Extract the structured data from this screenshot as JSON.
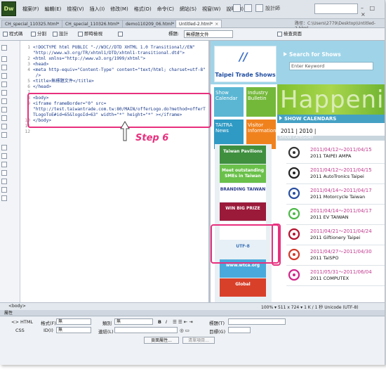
{
  "app": {
    "logo": "Dw"
  },
  "menubar": {
    "items": [
      "檔案(F)",
      "編輯(E)",
      "檢視(V)",
      "插入(I)",
      "修改(M)",
      "格式(O)",
      "命令(C)",
      "網站(S)",
      "視窗(W)",
      "說明(H)"
    ],
    "workspace": "設計師",
    "window_controls": "– □ ×"
  },
  "tabs": [
    {
      "label": "CH_special_110325.html*",
      "close": "×"
    },
    {
      "label": "CH_special_110326.html*",
      "close": "×"
    },
    {
      "label": "demo110209_06.html*",
      "close": "×"
    },
    {
      "label": "Untitled-2.html*",
      "close": "×"
    }
  ],
  "path": "路徑：C:\\Users\\2779\\Desktop\\Untitled-2.html",
  "toolbar": {
    "code": "程式碼",
    "split": "分割",
    "design": "設計",
    "live_view": "即時檢視",
    "title_label": "標題:",
    "title_value": "無標題文件",
    "check_page": "檢查頁面"
  },
  "code_lines": [
    {
      "n": "1",
      "text": "<!DOCTYPE html PUBLIC \"-//W3C//DTD XHTML 1.0 Transitional//EN\""
    },
    {
      "n": "",
      "text": "\"http://www.w3.org/TR/xhtml1/DTD/xhtml1-transitional.dtd\">"
    },
    {
      "n": "2",
      "text": "<html xmlns=\"http://www.w3.org/1999/xhtml\">"
    },
    {
      "n": "3",
      "text": "<head>"
    },
    {
      "n": "4",
      "text": "<meta http-equiv=\"Content-Type\" content=\"text/html; charset=utf-8\""
    },
    {
      "n": "",
      "text": " />"
    },
    {
      "n": "5",
      "text": "<title>無標題文件</title>"
    },
    {
      "n": "6",
      "text": "</head>"
    },
    {
      "n": "7",
      "text": ""
    },
    {
      "n": "8",
      "text": "<body>"
    },
    {
      "n": "9",
      "text": "<iframe frameBorder=\"0\" src="
    },
    {
      "n": "",
      "text": "\"http://test.taiwantrade.com.tw:80/MAIN/offerLogo.do?method=offerT"
    },
    {
      "n": "",
      "text": "TLogoToE#id=65&logoId=63\" width=\"*\" height=\"*\" ></iframe>"
    },
    {
      "n": "10",
      "text": "</body>"
    },
    {
      "n": "11",
      "text": ""
    },
    {
      "n": "12",
      "text": ""
    }
  ],
  "annotation": {
    "step": "Step 6"
  },
  "site": {
    "brand": "Taipei Trade Shows",
    "search_title": "Search for Shows",
    "keyword_placeholder": "Enter Keyword",
    "tiles": [
      {
        "label": "Show Calendar",
        "color": "#5bb6d3"
      },
      {
        "label": "Industry Bulletin",
        "color": "#74b83a"
      },
      {
        "label": "TAITRA News",
        "color": "#2f9ac4"
      },
      {
        "label": "Visitor Information",
        "color": "#f0821e"
      }
    ],
    "banner_text": "Happenin",
    "show_calendars": "SHOW CALENDARS",
    "years": "2011 | 2010 |",
    "show_category": "SHOW CATEGORY",
    "ads": [
      {
        "label": "Taiwan Pavilions",
        "bg": "#3f8f3f",
        "fg": "#ffffff"
      },
      {
        "label": "Meet outstanding SMEs in Taiwan",
        "bg": "#6ac04a",
        "fg": "#ffffff"
      },
      {
        "label": "BRANDING TAIWAN",
        "bg": "#ffffff",
        "fg": "#2b3b8a"
      },
      {
        "label": "WIN BIG PRIZE",
        "bg": "#9b1a3a",
        "fg": "#ffffff"
      },
      {
        "label": "",
        "bg": "#ffffff",
        "fg": "#333333"
      },
      {
        "label": "UTF-8",
        "bg": "#e6f0f6",
        "fg": "#3b6fb6"
      },
      {
        "label": "www.wtca.org",
        "bg": "#4aa9dc",
        "fg": "#ffffff"
      },
      {
        "label": "Global",
        "bg": "#d8402a",
        "fg": "#ffffff"
      }
    ],
    "events": [
      {
        "date": "2011/04/12～2011/04/15",
        "name": "2011 TAIPEI AMPA",
        "icon": "wheel-icon",
        "color": "#333333"
      },
      {
        "date": "2011/04/12～2011/04/15",
        "name": "2011 AutoTronics Taipei",
        "icon": "steering-icon",
        "color": "#222222"
      },
      {
        "date": "2011/04/14～2011/04/17",
        "name": "2011 Motorcycle Taiwan",
        "icon": "motorcycle-icon",
        "color": "#2a4fa3"
      },
      {
        "date": "2011/04/14～2011/04/17",
        "name": "2011 EV TAIWAN",
        "icon": "ev-icon",
        "color": "#4cb848"
      },
      {
        "date": "2011/04/21～2011/04/24",
        "name": "2011 Giftionery Taipei",
        "icon": "gift-flag-icon",
        "color": "#b5122f"
      },
      {
        "date": "2011/04/27～2011/04/30",
        "name": "2011 TaiSPO",
        "icon": "sport-icon",
        "color": "#d23a2a"
      },
      {
        "date": "2011/05/31～2011/06/04",
        "name": "2011 COMPUTEX",
        "icon": "computex-icon",
        "color": "#d3248a"
      }
    ]
  },
  "statusbar": {
    "tag": "<body>",
    "info": "100% ▾  511 x 724 ▾  1 K / 1 秒  Unicode (UTF-8)"
  },
  "properties": {
    "header": "屬性",
    "html_label": "<> HTML",
    "css_label": "CSS",
    "format_label": "格式(F)",
    "format_value": "無",
    "id_label": "ID(I)",
    "id_value": "無",
    "class_label": "類別",
    "class_value": "無",
    "link_label": "連結(L)",
    "title_label": "標題(T)",
    "target_label": "目標(G)",
    "page_props_button": "頁面屬性...",
    "list_item_button": "清單項目..."
  }
}
